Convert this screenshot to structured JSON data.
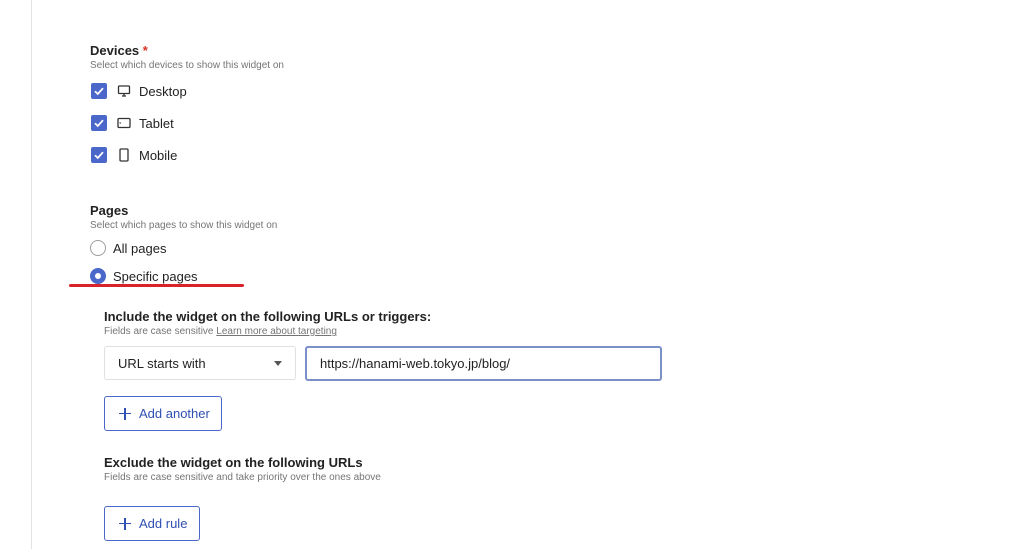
{
  "devices": {
    "title": "Devices",
    "required_mark": "*",
    "hint": "Select which devices to show this widget on",
    "options": [
      {
        "label": "Desktop",
        "checked": true,
        "icon": "desktop-icon"
      },
      {
        "label": "Tablet",
        "checked": true,
        "icon": "tablet-icon"
      },
      {
        "label": "Mobile",
        "checked": true,
        "icon": "mobile-icon"
      }
    ]
  },
  "pages": {
    "title": "Pages",
    "hint": "Select which pages to show this widget on",
    "options": [
      {
        "label": "All pages",
        "selected": false
      },
      {
        "label": "Specific pages",
        "selected": true
      }
    ]
  },
  "include": {
    "title": "Include the widget on the following URLs or triggers:",
    "hint": "Fields are case sensitive",
    "learn_more": "Learn more about targeting",
    "match_type": "URL starts with",
    "url_value": "https://hanami-web.tokyo.jp/blog/",
    "add_button": "Add another"
  },
  "exclude": {
    "title": "Exclude the widget on the following URLs",
    "hint": "Fields are case sensitive and take priority over the ones above",
    "add_button": "Add rule"
  },
  "colors": {
    "accent": "#4a67c9",
    "annotation_underline": "#d8232a",
    "required": "#d93025"
  }
}
